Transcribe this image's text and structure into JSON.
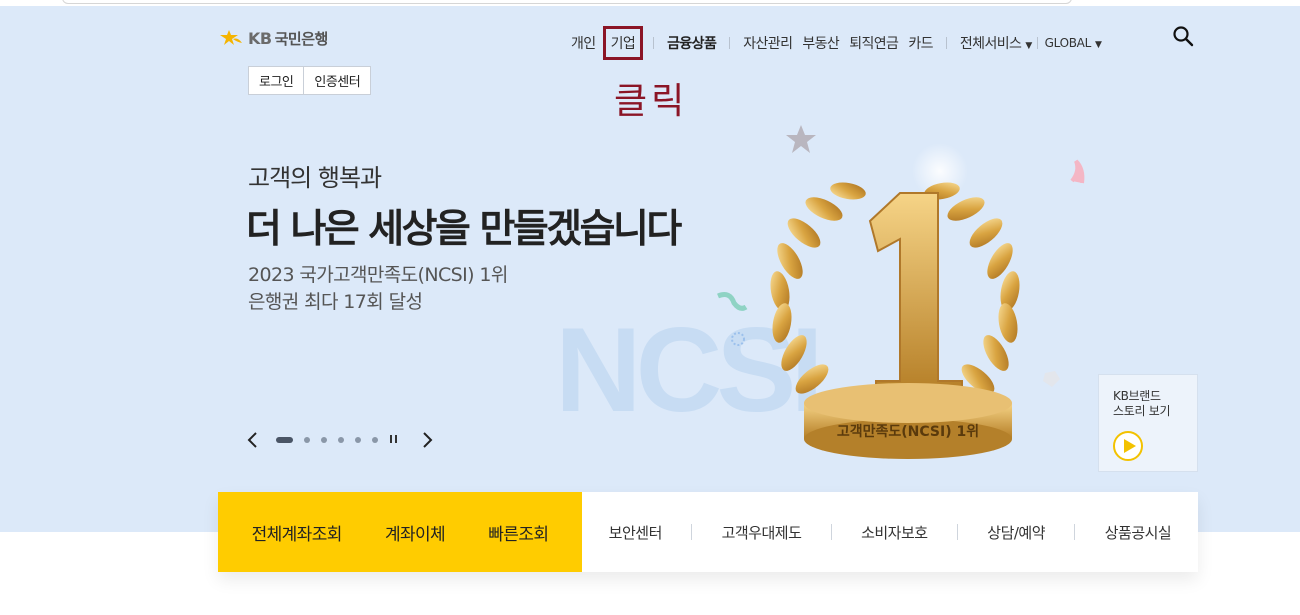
{
  "header": {
    "logo_kb": "KB",
    "logo_name": "국민은행",
    "nav": [
      {
        "label": "개인"
      },
      {
        "label": "기업"
      },
      {
        "label": "금융상품"
      },
      {
        "label": "자산관리"
      },
      {
        "label": "부동산"
      },
      {
        "label": "퇴직연금"
      },
      {
        "label": "카드"
      },
      {
        "label": "전체서비스"
      },
      {
        "label": "GLOBAL"
      }
    ],
    "login": "로그인",
    "cert_center": "인증센터"
  },
  "annotation": "클릭",
  "hero": {
    "subtitle": "고객의 행복과",
    "title": "더 나은 세상을 만들겠습니다",
    "desc_line1": "2023 국가고객만족도(NCSI) 1위",
    "desc_line2": "은행권 최다 17회 달성",
    "bg_text": "NCSI",
    "trophy_number": "1",
    "trophy_caption": "고객만족도(NCSI) 1위"
  },
  "carousel": {
    "slides": 6,
    "active_index": 0
  },
  "brand_story": {
    "label": "KB브랜드\n스토리 보기"
  },
  "quick": {
    "primary": [
      "전체계좌조회",
      "계좌이체",
      "빠른조회"
    ],
    "links": [
      "보안센터",
      "고객우대제도",
      "소비자보호",
      "상담/예약",
      "상품공시실"
    ]
  },
  "colors": {
    "hero_bg": "#dce9f9",
    "accent_yellow": "#ffcc00",
    "annotation_red": "#8b1526"
  }
}
